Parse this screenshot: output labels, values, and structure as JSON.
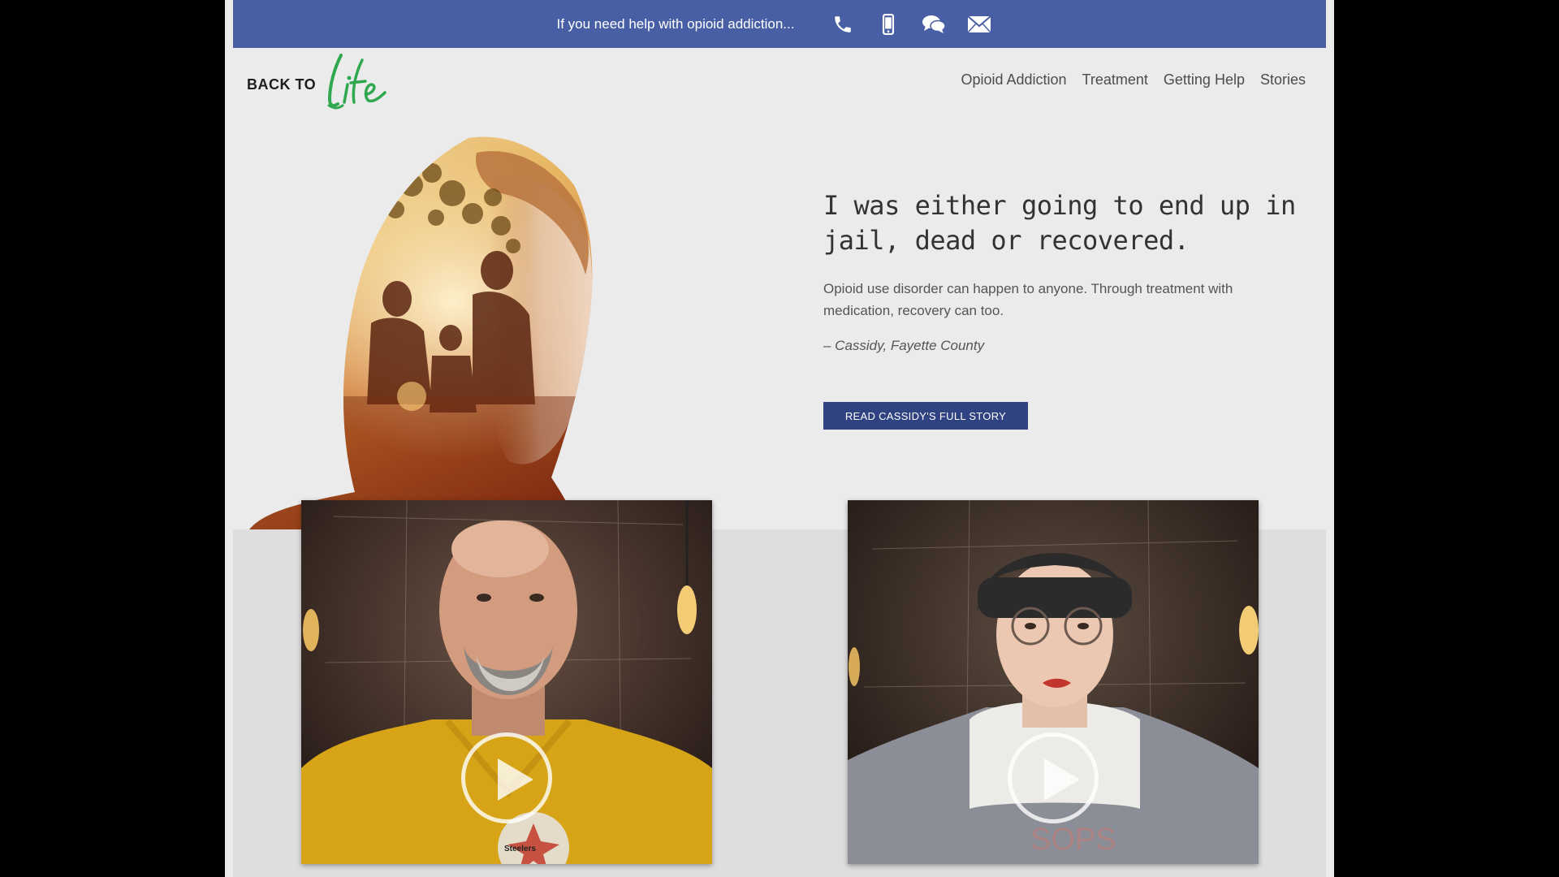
{
  "helpbar": {
    "text": "If you need help with opioid addiction...",
    "icons": [
      "phone-icon",
      "mobile-icon",
      "chat-icon",
      "email-icon"
    ]
  },
  "logo": {
    "prefix": "BACK TO",
    "script": "Life"
  },
  "nav": {
    "items": [
      {
        "label": "Opioid Addiction"
      },
      {
        "label": "Treatment"
      },
      {
        "label": "Getting Help"
      },
      {
        "label": "Stories"
      }
    ]
  },
  "hero": {
    "quote": "I was either going to end up in jail, dead or recovered.",
    "body": "Opioid use disorder can happen to anyone. Through treatment with medication, recovery can too.",
    "attribution": "– Cassidy, Fayette County",
    "cta_label": "READ CASSIDY'S FULL STORY"
  },
  "videos": [
    {
      "shirt_logo": "Steelers"
    },
    {
      "hoodie_text": "SOPS"
    }
  ],
  "colors": {
    "helpbar": "#485fa5",
    "cta": "#2f4282",
    "logo_green": "#2fa84f",
    "page_bg": "#ebebeb"
  }
}
